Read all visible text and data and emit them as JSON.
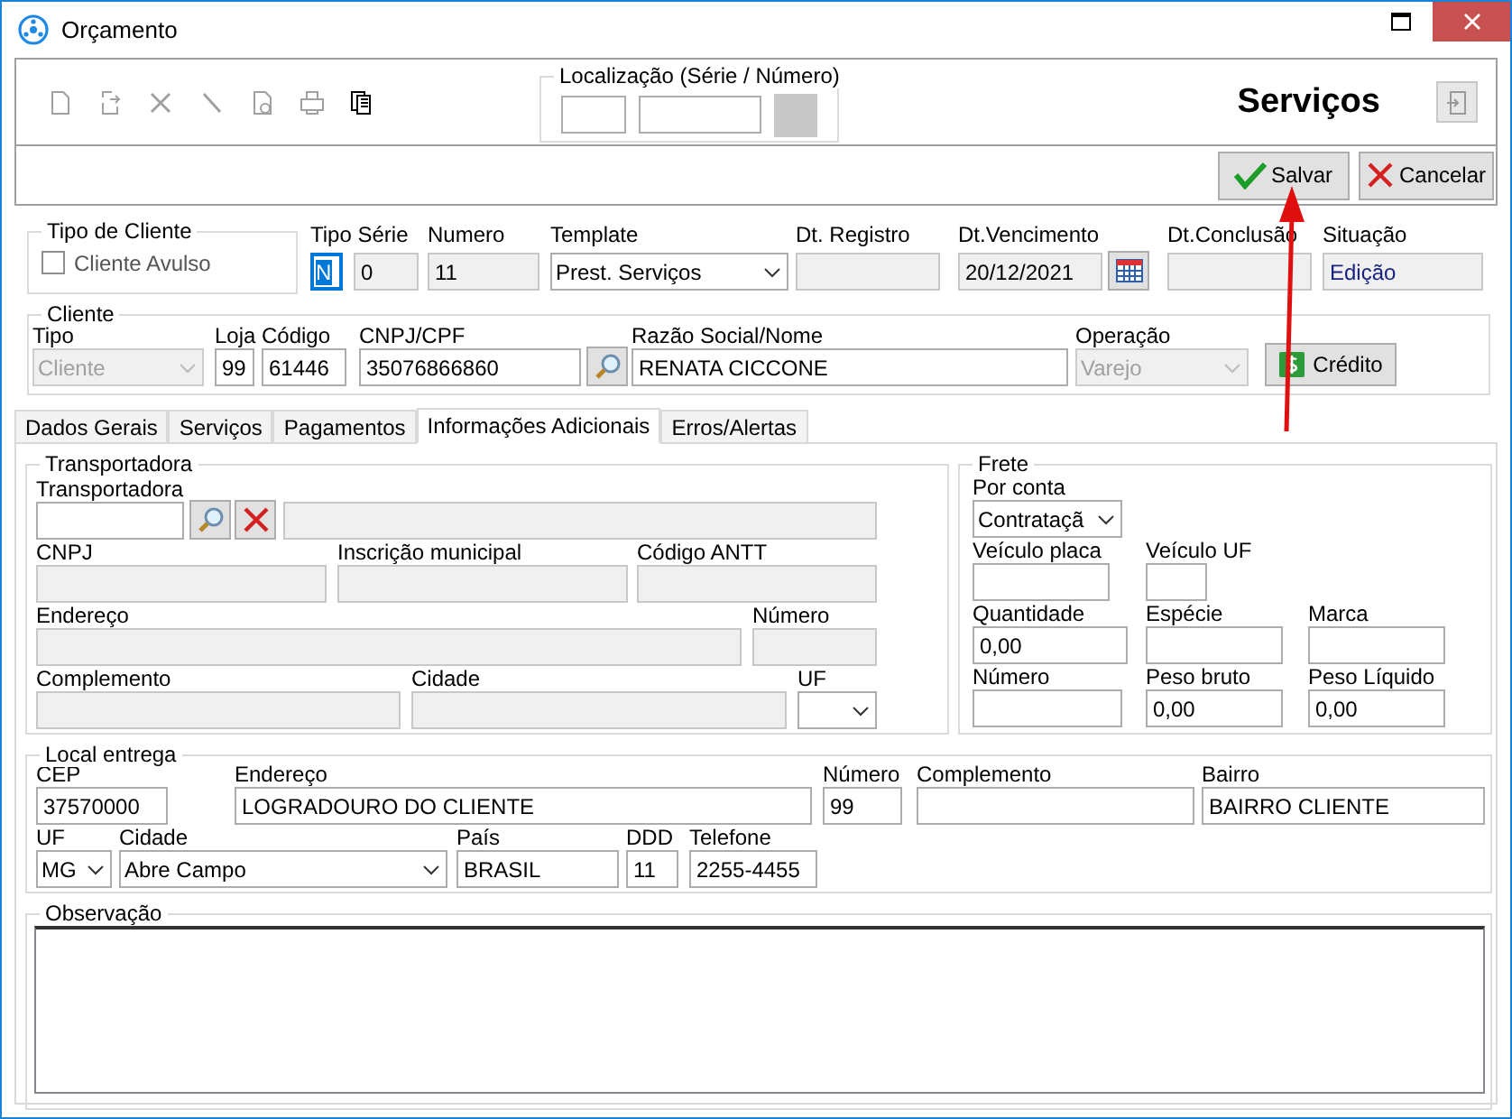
{
  "window": {
    "title": "Orçamento"
  },
  "toolbar": {
    "tools": [
      {
        "kind": "new",
        "disabled": true
      },
      {
        "kind": "edit",
        "disabled": true
      },
      {
        "kind": "delete",
        "disabled": true
      },
      {
        "kind": "pen",
        "disabled": true
      },
      {
        "kind": "preview",
        "disabled": true
      },
      {
        "kind": "print",
        "disabled": true
      },
      {
        "kind": "copy",
        "disabled": false
      }
    ],
    "location": {
      "legend": "Localização (Série / Número)"
    },
    "heading": "Serviços"
  },
  "actions": [
    {
      "kind": "save",
      "label": "Salvar"
    },
    {
      "kind": "cancel",
      "label": "Cancelar"
    }
  ],
  "client_type": {
    "legend": "Tipo de Cliente",
    "label": "Cliente Avulso",
    "checked": false
  },
  "header_fields": [
    {
      "label": "Tipo Série",
      "kind": "focused",
      "value": "N"
    },
    {
      "kind": "readonly",
      "value": "0"
    },
    {
      "label": "Numero",
      "kind": "readonly",
      "value": "11"
    },
    {
      "label": "Template",
      "kind": "select",
      "value": "Prest. Serviços",
      "disabled": false
    },
    {
      "label": "Dt. Registro",
      "kind": "readonly"
    },
    {
      "label": "Dt.Vencimento",
      "kind": "readonly",
      "value": "20/12/2021"
    },
    {
      "kind": "calendar"
    },
    {
      "label": "Dt.Conclusão",
      "kind": "readonly"
    },
    {
      "label": "Situação",
      "kind": "status",
      "value": "Edição"
    }
  ],
  "cliente": {
    "legend": "Cliente",
    "fields": [
      {
        "label": "Tipo",
        "kind": "select",
        "value": "Cliente",
        "disabled": true
      },
      {
        "label": "Loja",
        "kind": "text",
        "value": "99"
      },
      {
        "label": "Código",
        "kind": "text",
        "value": "61446"
      },
      {
        "label": "CNPJ/CPF",
        "kind": "text",
        "value": "35076866860"
      },
      {
        "kind": "search"
      },
      {
        "label": "Razão Social/Nome",
        "kind": "text",
        "value": "RENATA CICCONE"
      },
      {
        "label": "Operação",
        "kind": "select",
        "value": "Varejo",
        "disabled": true
      },
      {
        "kind": "credit",
        "value": "Crédito"
      }
    ]
  },
  "tabs": [
    {
      "label": "Dados Gerais",
      "selected": false
    },
    {
      "label": "Serviços",
      "selected": false
    },
    {
      "label": "Pagamentos",
      "selected": false
    },
    {
      "label": "Informações Adicionais",
      "selected": true
    },
    {
      "label": "Erros/Alertas",
      "selected": false
    }
  ],
  "transportadora": {
    "legend": "Transportadora",
    "rows": [
      [
        {
          "label": "Transportadora",
          "kind": "text"
        },
        {
          "kind": "search"
        },
        {
          "kind": "clear"
        },
        {
          "kind": "readonly"
        }
      ],
      [
        {
          "label": "CNPJ",
          "kind": "readonly"
        },
        {
          "label": "Inscrição municipal",
          "kind": "readonly"
        },
        {
          "label": "Código ANTT",
          "kind": "readonly"
        }
      ],
      [
        {
          "label": "Endereço",
          "kind": "readonly"
        },
        {
          "label": "Número",
          "kind": "readonly"
        }
      ],
      [
        {
          "label": "Complemento",
          "kind": "readonly"
        },
        {
          "label": "Cidade",
          "kind": "readonly"
        },
        {
          "label": "UF",
          "kind": "select",
          "disabled": false
        }
      ]
    ]
  },
  "frete": {
    "legend": "Frete",
    "rows": [
      [
        {
          "label": "Por conta",
          "kind": "select",
          "value": "Contrataçã",
          "disabled": false
        }
      ],
      [
        {
          "label": "Veículo placa",
          "kind": "text"
        },
        {
          "label": "Veículo UF",
          "kind": "text"
        }
      ],
      [
        {
          "label": "Quantidade",
          "kind": "text",
          "value": "0,00"
        },
        {
          "label": "Espécie",
          "kind": "text"
        },
        {
          "label": "Marca",
          "kind": "text"
        }
      ],
      [
        {
          "label": "Número",
          "kind": "text"
        },
        {
          "label": "Peso bruto",
          "kind": "text",
          "value": "0,00"
        },
        {
          "label": "Peso Líquido",
          "kind": "text",
          "value": "0,00"
        }
      ]
    ]
  },
  "local_entrega": {
    "legend": "Local entrega",
    "lines": [
      {
        "fields": [
          {
            "label": "CEP",
            "kind": "text",
            "value": "37570000"
          },
          {
            "label": "Endereço",
            "kind": "text",
            "value": "LOGRADOURO DO CLIENTE"
          },
          {
            "label": "Número",
            "kind": "text",
            "value": "99"
          },
          {
            "label": "Complemento",
            "kind": "text"
          },
          {
            "label": "Bairro",
            "kind": "text",
            "value": "BAIRRO CLIENTE"
          }
        ]
      },
      {
        "fields": [
          {
            "label": "UF",
            "kind": "select",
            "value": "MG",
            "disabled": false
          },
          {
            "label": "Cidade",
            "kind": "select",
            "value": "Abre Campo",
            "disabled": false
          },
          {
            "label": "País",
            "kind": "text",
            "value": "BRASIL"
          },
          {
            "label": "DDD",
            "kind": "text",
            "value": "11"
          },
          {
            "label": "Telefone",
            "kind": "text",
            "value": "2255-4455"
          }
        ]
      }
    ]
  },
  "observacao": {
    "legend": "Observação"
  }
}
